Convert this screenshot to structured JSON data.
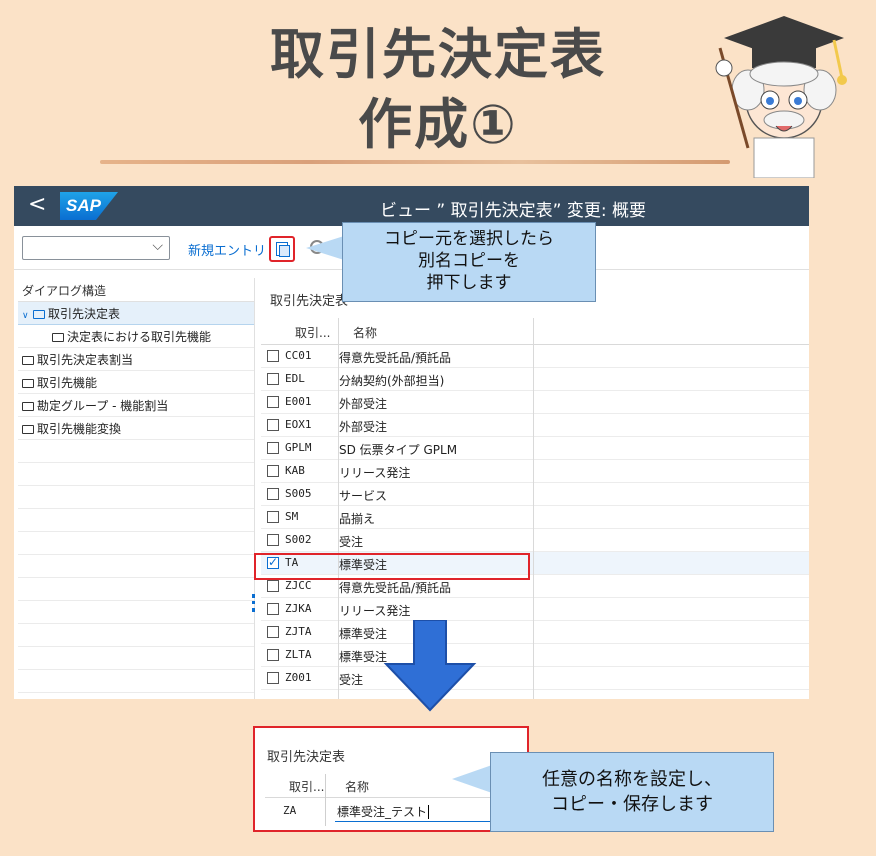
{
  "page_title": {
    "line1": "取引先決定表",
    "line2": "作成①"
  },
  "shell": {
    "back_glyph": "<",
    "logo_text": "SAP",
    "title": "ビュー ” 取引先決定表” 変更: 概要"
  },
  "toolbar": {
    "dropdown_value": "",
    "new_entry_label": "新規エントリ"
  },
  "callouts": {
    "copy_hint": {
      "line1": "コピー元を選択したら",
      "line2": "別名コピーを",
      "line3": "押下します"
    },
    "save_hint": {
      "line1": "任意の名称を設定し、",
      "line2": "コピー・保存します"
    }
  },
  "left_panel": {
    "header": "ダイアログ構造",
    "items": [
      {
        "label": "取引先決定表",
        "expanded": true,
        "selected": true
      },
      {
        "label": "決定表における取引先機能",
        "child": true
      },
      {
        "label": "取引先決定表割当"
      },
      {
        "label": "取引先機能"
      },
      {
        "label": "勘定グループ - 機能割当"
      },
      {
        "label": "取引先機能変換"
      }
    ]
  },
  "main": {
    "section_title": "取引先決定表",
    "columns": {
      "code": "取引...",
      "name": "名称"
    },
    "rows": [
      {
        "code": "CC01",
        "name": "得意先受託品/預託品",
        "checked": false
      },
      {
        "code": "EDL",
        "name": "分納契約(外部担当)",
        "checked": false
      },
      {
        "code": "E001",
        "name": "外部受注",
        "checked": false
      },
      {
        "code": "EOX1",
        "name": "外部受注",
        "checked": false
      },
      {
        "code": "GPLM",
        "name": "SD 伝票タイプ GPLM",
        "checked": false
      },
      {
        "code": "KAB",
        "name": "リリース発注",
        "checked": false
      },
      {
        "code": "S005",
        "name": "サービス",
        "checked": false
      },
      {
        "code": "SM",
        "name": "品揃え",
        "checked": false
      },
      {
        "code": "S002",
        "name": "受注",
        "checked": false
      },
      {
        "code": "TA",
        "name": "標準受注",
        "checked": true
      },
      {
        "code": "ZJCC",
        "name": "得意先受託品/預託品",
        "checked": false
      },
      {
        "code": "ZJKA",
        "name": "リリース発注",
        "checked": false
      },
      {
        "code": "ZJTA",
        "name": "標準受注",
        "checked": false
      },
      {
        "code": "ZLTA",
        "name": "標準受注",
        "checked": false
      },
      {
        "code": "Z001",
        "name": "受注",
        "checked": false
      }
    ]
  },
  "copy_result": {
    "section_title": "取引先決定表",
    "columns": {
      "code": "取引...",
      "name": "名称"
    },
    "row": {
      "code": "ZA",
      "name": "標準受注_テスト"
    }
  },
  "colors": {
    "background": "#fbe2c7",
    "shell": "#354a5f",
    "accent": "#0a6ed1",
    "highlight": "#e0242a",
    "callout": "#b9d9f4",
    "arrow": "#2f6fd6"
  },
  "icons": [
    "back-chevron-icon",
    "dropdown-chevron-icon",
    "copy-as-icon",
    "folder-icon",
    "checkbox-icon",
    "down-arrow-icon"
  ]
}
